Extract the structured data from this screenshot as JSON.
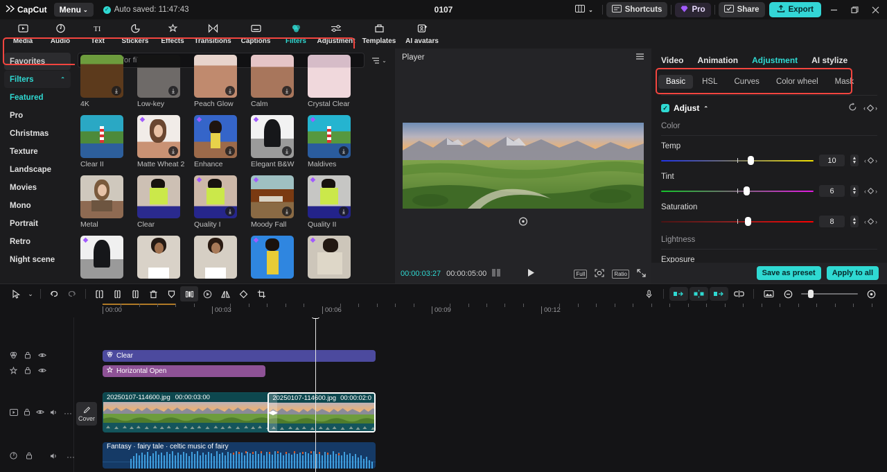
{
  "titlebar": {
    "brand": "CapCut",
    "menu_label": "Menu",
    "autosave_text": "Auto saved: 11:47:43",
    "project_title": "0107",
    "layout_icon": "layout-icon",
    "shortcuts_label": "Shortcuts",
    "pro_label": "Pro",
    "share_label": "Share",
    "export_label": "Export",
    "minimize_icon": "minimize-icon",
    "restore_icon": "restore-icon",
    "close_icon": "close-icon",
    "accent": "#33d6d6"
  },
  "tabstrip": {
    "active": "Filters",
    "tabs": [
      {
        "label": "Media",
        "icon": "media-icon"
      },
      {
        "label": "Audio",
        "icon": "audio-icon"
      },
      {
        "label": "Text",
        "icon": "text-icon"
      },
      {
        "label": "Stickers",
        "icon": "stickers-icon"
      },
      {
        "label": "Effects",
        "icon": "effects-icon"
      },
      {
        "label": "Transitions",
        "icon": "transitions-icon"
      },
      {
        "label": "Captions",
        "icon": "captions-icon"
      },
      {
        "label": "Filters",
        "icon": "filters-icon"
      },
      {
        "label": "Adjustment",
        "icon": "adjustment-icon"
      },
      {
        "label": "Templates",
        "icon": "templates-icon"
      },
      {
        "label": "AI avatars",
        "icon": "ai-avatars-icon"
      }
    ]
  },
  "leftnav": {
    "items": [
      {
        "label": "Favorites",
        "type": "sel"
      },
      {
        "label": "Filters",
        "type": "group"
      },
      {
        "label": "Featured",
        "type": "active"
      },
      {
        "label": "Pro",
        "type": "sub"
      },
      {
        "label": "Christmas",
        "type": "sub"
      },
      {
        "label": "Texture",
        "type": "sub"
      },
      {
        "label": "Landscape",
        "type": "sub"
      },
      {
        "label": "Movies",
        "type": "sub"
      },
      {
        "label": "Mono",
        "type": "sub"
      },
      {
        "label": "Portrait",
        "type": "sub"
      },
      {
        "label": "Retro",
        "type": "sub"
      },
      {
        "label": "Night scene",
        "type": "sub"
      }
    ]
  },
  "filters": {
    "search_placeholder": "Search for filters",
    "sort_icon": "sort-filter-icon",
    "rows": [
      [
        {
          "name": "4K",
          "download": true,
          "pro": false,
          "art": "land-brown"
        },
        {
          "name": "Low-key",
          "download": true,
          "pro": false,
          "art": "dark-grey"
        },
        {
          "name": "Peach Glow",
          "download": true,
          "pro": false,
          "art": "peach"
        },
        {
          "name": "Calm",
          "download": true,
          "pro": false,
          "art": "calm"
        },
        {
          "name": "Crystal Clear",
          "download": false,
          "pro": false,
          "art": "pink"
        }
      ],
      [
        {
          "name": "Clear II",
          "download": false,
          "pro": false,
          "art": "lighthouse"
        },
        {
          "name": "Matte Wheat 2",
          "download": true,
          "pro": true,
          "art": "portrait-warm"
        },
        {
          "name": "Enhance",
          "download": true,
          "pro": true,
          "art": "yellow-dress"
        },
        {
          "name": "Elegant B&W",
          "download": true,
          "pro": true,
          "art": "bw"
        },
        {
          "name": "Maldives",
          "download": true,
          "pro": true,
          "art": "lighthouse"
        }
      ],
      [
        {
          "name": "Metal",
          "download": false,
          "pro": false,
          "art": "man-portrait"
        },
        {
          "name": "Clear",
          "download": false,
          "pro": false,
          "art": "neon-green"
        },
        {
          "name": "Quality I",
          "download": true,
          "pro": true,
          "art": "neon-green"
        },
        {
          "name": "Moody Fall",
          "download": true,
          "pro": true,
          "art": "fall"
        },
        {
          "name": "Quality II",
          "download": true,
          "pro": true,
          "art": "neon-green"
        }
      ],
      [
        {
          "name": "",
          "download": false,
          "pro": true,
          "art": "bw"
        },
        {
          "name": "",
          "download": false,
          "pro": false,
          "art": "woman1"
        },
        {
          "name": "",
          "download": false,
          "pro": false,
          "art": "woman2"
        },
        {
          "name": "",
          "download": false,
          "pro": true,
          "art": "yellow-top"
        },
        {
          "name": "",
          "download": false,
          "pro": true,
          "art": "beige-suit"
        }
      ]
    ]
  },
  "player": {
    "title": "Player",
    "menu_icon": "hamburger-icon",
    "reset_icon": "reset-icon",
    "current_time": "00:00:03:27",
    "total_time": "00:00:05:00",
    "frames_icon": "frames-icon",
    "play_icon": "play-icon",
    "full_label": "Full",
    "focus_icon": "focus-icon",
    "ratio_label": "Ratio",
    "expand_icon": "expand-icon"
  },
  "inspector": {
    "tabs": [
      {
        "label": "Video",
        "active": false
      },
      {
        "label": "Animation",
        "active": false
      },
      {
        "label": "Adjustment",
        "active": true
      },
      {
        "label": "AI stylize",
        "active": false
      }
    ],
    "subtabs": [
      {
        "label": "Basic",
        "active": true
      },
      {
        "label": "HSL",
        "active": false
      },
      {
        "label": "Curves",
        "active": false
      },
      {
        "label": "Color wheel",
        "active": false
      },
      {
        "label": "Mask",
        "active": false
      }
    ],
    "adjust_label": "Adjust",
    "reset_icon": "reset-icon",
    "keyframe_icon": "keyframe-icon",
    "color_section": "Color",
    "lightness_section": "Lightness",
    "sliders": [
      {
        "name": "Temp",
        "value": "10",
        "rail": "temp",
        "knob_pct": 60
      },
      {
        "name": "Tint",
        "value": "6",
        "rail": "tint",
        "knob_pct": 54
      },
      {
        "name": "Saturation",
        "value": "8",
        "rail": "sat",
        "knob_pct": 58
      }
    ],
    "exposure_label": "Exposure",
    "save_preset_label": "Save as preset",
    "apply_all_label": "Apply to all"
  },
  "timeline": {
    "toolbar_left": [
      {
        "icon": "select-arrow-icon",
        "state": "normal"
      },
      {
        "icon": "chevron-down-icon",
        "state": "normal"
      },
      {
        "icon": "undo-icon",
        "state": "normal"
      },
      {
        "icon": "redo-icon",
        "state": "dim"
      },
      {
        "icon": "split-icon",
        "state": "normal"
      },
      {
        "icon": "trim-left-icon",
        "state": "normal"
      },
      {
        "icon": "trim-right-icon",
        "state": "normal"
      },
      {
        "icon": "delete-icon",
        "state": "normal"
      },
      {
        "icon": "freeze-icon",
        "state": "normal"
      },
      {
        "icon": "crop-sides-icon",
        "state": "on"
      },
      {
        "icon": "speed-icon",
        "state": "normal"
      },
      {
        "icon": "mirror-icon",
        "state": "normal"
      },
      {
        "icon": "rotate-icon",
        "state": "normal"
      },
      {
        "icon": "crop-icon",
        "state": "normal"
      }
    ],
    "toolbar_right": [
      {
        "icon": "mic-record-icon",
        "state": "normal"
      },
      {
        "icon": "snap-left-icon",
        "state": "on"
      },
      {
        "icon": "auto-snap-icon",
        "state": "on"
      },
      {
        "icon": "snap-right-icon",
        "state": "on"
      },
      {
        "icon": "link-icon",
        "state": "normal"
      },
      {
        "icon": "preview-icon",
        "state": "normal"
      },
      {
        "icon": "zoom-out-icon",
        "state": "normal"
      },
      {
        "icon": "zoom-in-icon",
        "state": "normal"
      }
    ],
    "ruler_labels": [
      "00:00",
      "00:03",
      "00:06",
      "00:09",
      "00:12"
    ],
    "tracks": [
      {
        "type": "filter",
        "icon": "filter-track-icon",
        "label": "Clear"
      },
      {
        "type": "animation",
        "icon": "anim-track-icon",
        "label": "Horizontal Open"
      },
      {
        "type": "video",
        "icon": "video-track-icon",
        "cover_label": "Cover",
        "clips": [
          {
            "name": "20250107-114600.jpg",
            "duration": "00:00:03:00",
            "selected": false
          },
          {
            "name": "20250107-114600.jpg",
            "duration": "00:00:02:0",
            "selected": true
          }
        ]
      },
      {
        "type": "audio",
        "icon": "audio-track-icon",
        "label": "Fantasy · fairy tale · celtic music of fairy"
      }
    ],
    "head_icons": {
      "lock": "lock-icon",
      "eye": "eye-icon",
      "mute": "speaker-icon",
      "more": "more-icon"
    }
  }
}
